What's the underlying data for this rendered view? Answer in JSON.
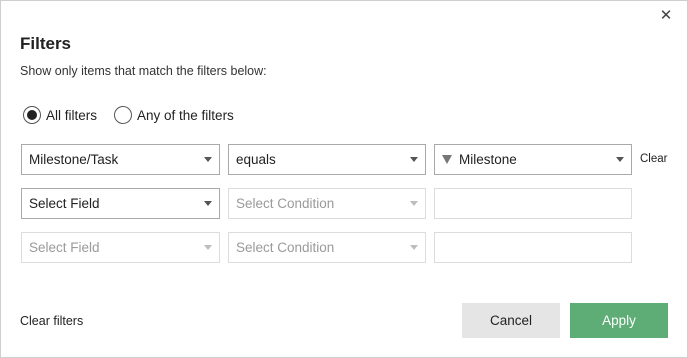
{
  "dialog": {
    "title": "Filters",
    "subtitle": "Show only items that match the filters below:",
    "close_icon": "close-icon",
    "close_glyph": "✕"
  },
  "match_mode": {
    "options": [
      {
        "label": "All filters",
        "selected": true
      },
      {
        "label": "Any of the filters",
        "selected": false
      }
    ]
  },
  "rows": [
    {
      "field": "Milestone/Task",
      "condition": "equals",
      "value": "Milestone",
      "value_icon": "funnel-icon",
      "clear_label": "Clear"
    },
    {
      "field": "Select Field",
      "condition": "Select Condition",
      "value": ""
    },
    {
      "field": "Select Field",
      "condition": "Select Condition",
      "value": ""
    }
  ],
  "footer": {
    "clear_filters_label": "Clear filters",
    "cancel_label": "Cancel",
    "apply_label": "Apply"
  },
  "colors": {
    "apply_bg": "#5fad76",
    "cancel_bg": "#e5e5e5"
  }
}
